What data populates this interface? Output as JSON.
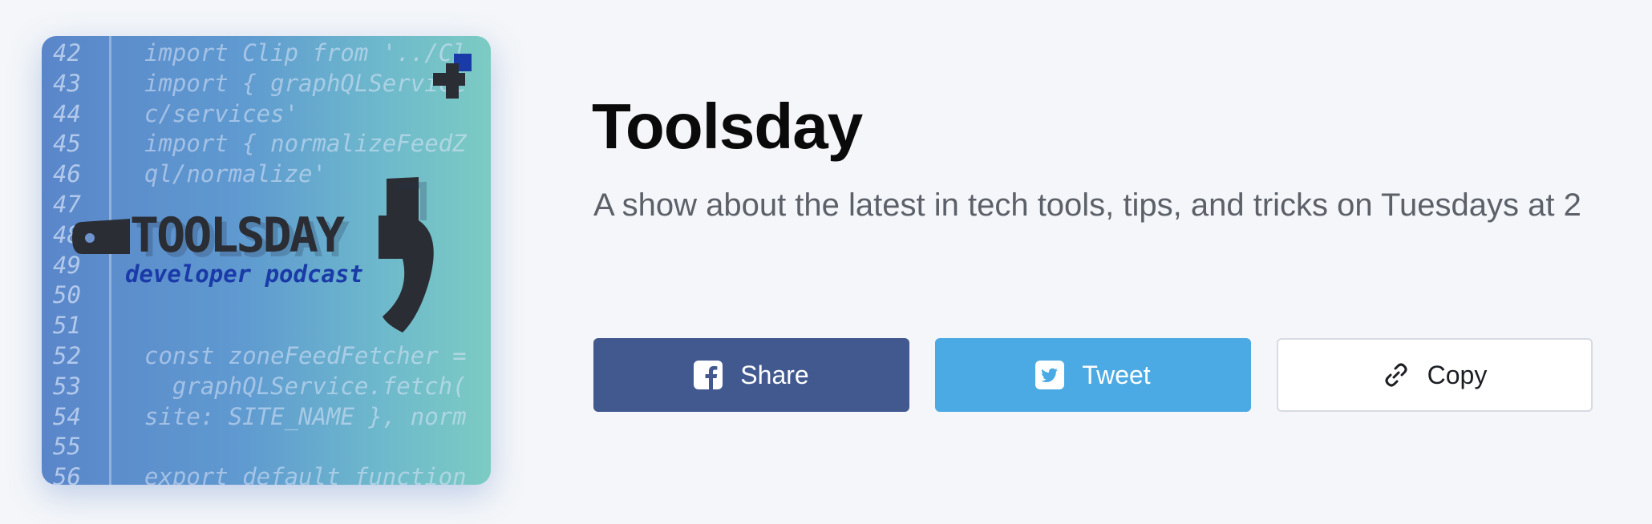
{
  "podcast": {
    "title": "Toolsday",
    "description": "A show about the latest in tech tools, tips, and tricks on Tuesdays at 2"
  },
  "artwork": {
    "logo_text": "TOOLSDAY",
    "logo_subtitle": "developer podcast",
    "code_lines": [
      {
        "num": "42",
        "text": "import Clip from '../Cl"
      },
      {
        "num": "43",
        "text": "import { graphQLService"
      },
      {
        "num": "44",
        "text": "c/services'"
      },
      {
        "num": "45",
        "text": "import { normalizeFeedZ"
      },
      {
        "num": "46",
        "text": "ql/normalize'"
      },
      {
        "num": "47",
        "text": ""
      },
      {
        "num": "48",
        "text": ""
      },
      {
        "num": "49",
        "text": ""
      },
      {
        "num": "50",
        "text": ""
      },
      {
        "num": "51",
        "text": ""
      },
      {
        "num": "52",
        "text": "const zoneFeedFetcher ="
      },
      {
        "num": "53",
        "text": "  graphQLService.fetch("
      },
      {
        "num": "54",
        "text": "site: SITE_NAME }, norm"
      },
      {
        "num": "55",
        "text": ""
      },
      {
        "num": "56",
        "text": "export default function"
      }
    ]
  },
  "share_buttons": [
    {
      "label": "Share",
      "icon": "facebook-icon",
      "color": "#42598f"
    },
    {
      "label": "Tweet",
      "icon": "twitter-icon",
      "color": "#4baae3"
    },
    {
      "label": "Copy",
      "icon": "link-icon",
      "color": "#ffffff"
    }
  ]
}
